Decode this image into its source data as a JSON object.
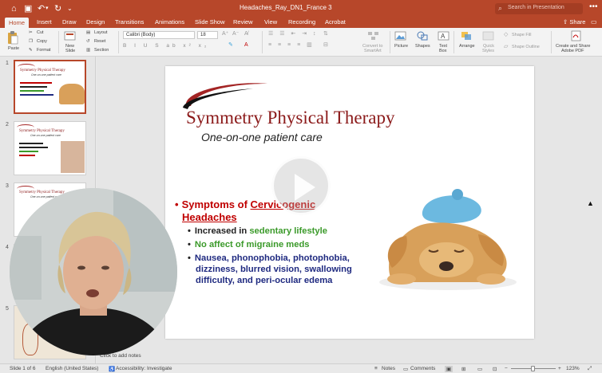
{
  "titlebar": {
    "doc_title": "Headaches_Ray_DN1_France 3",
    "search_placeholder": "Search in Presentation",
    "more": "•••"
  },
  "tabs": [
    "Home",
    "Insert",
    "Draw",
    "Design",
    "Transitions",
    "Animations",
    "Slide Show",
    "Review",
    "View",
    "Recording",
    "Acrobat"
  ],
  "share_label": "Share",
  "ribbon": {
    "paste": "Paste",
    "cut": "Cut",
    "copy": "Copy",
    "format": "Format",
    "new_slide_1": "New",
    "new_slide_2": "Slide",
    "layout": "Layout",
    "reset": "Reset",
    "section": "Section",
    "font_name": "Calibri (Body)",
    "font_size": "18",
    "format_glyphs": "B I U S ab x² x₂",
    "convert_1": "Convert to",
    "convert_2": "SmartArt",
    "picture": "Picture",
    "shapes": "Shapes",
    "textbox_1": "Text",
    "textbox_2": "Box",
    "arrange": "Arrange",
    "quick_styles_1": "Quick",
    "quick_styles_2": "Styles",
    "shape_fill": "Shape Fill",
    "shape_outline": "Shape Outline",
    "adobe_1": "Create and Share",
    "adobe_2": "Adobe PDF"
  },
  "thumbnails": [
    {
      "num": "1",
      "title": "Symmetry Physical Therapy",
      "sub": "One-on-one patient care"
    },
    {
      "num": "2",
      "title": "Symmetry Physical Therapy",
      "sub": "One-on-one patient care"
    },
    {
      "num": "3",
      "title": "Symmetry Physical Therapy",
      "sub": "One-on-one patient care"
    },
    {
      "num": "4"
    },
    {
      "num": "5"
    }
  ],
  "slide": {
    "title": "Symmetry Physical Therapy",
    "subtitle": "One-on-one patient care",
    "heading_pre": "Symptoms of ",
    "heading_link": "Cervicogenic",
    "heading_line2": "Headaches",
    "bullet1_pre": "Increased in ",
    "bullet1_green": "sedentary lifestyle",
    "bullet2": "No affect of migraine meds",
    "bullet3_l1": "Nausea, phonophobia, photophobia,",
    "bullet3_l2": "dizziness, blurred vision, swallowing",
    "bullet3_l3": "difficulty, and peri-ocular edema"
  },
  "notes_hint": "Click to add notes",
  "status": {
    "slide_of": "Slide 1 of 6",
    "language": "English (United States)",
    "accessibility": "Accessibility: Investigate",
    "notes": "Notes",
    "comments": "Comments",
    "zoom": "123%"
  },
  "colors": {
    "accent": "#b7472a",
    "title_red": "#8b1a1a",
    "heading_red": "#c00000",
    "green": "#3b9a2a",
    "navy": "#1f2a80"
  }
}
